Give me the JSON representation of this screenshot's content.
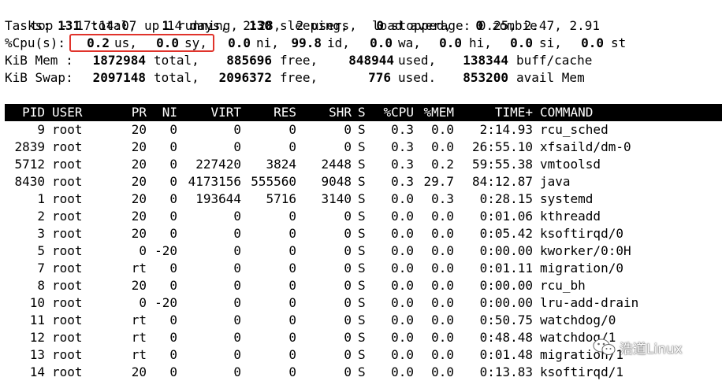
{
  "summary": {
    "line1": "top - 17:14:07 up 14 days,  2:28,  2 users,  load average: 0.25, 2.47, 2.91",
    "tasks": {
      "label": "Tasks:",
      "total": "131",
      "total_label": "total,",
      "running": "1",
      "running_label": "running,",
      "sleeping": "130",
      "sleeping_label": "sleeping,",
      "stopped": "0",
      "stopped_label": "stopped,",
      "zombie": "0",
      "zombie_label": "zombie"
    },
    "cpu": {
      "label": "%Cpu(s):",
      "us": "0.2",
      "us_label": "us,",
      "sy": "0.0",
      "sy_label": "sy,",
      "ni": "0.0",
      "ni_label": "ni,",
      "id": "99.8",
      "id_label": "id,",
      "wa": "0.0",
      "wa_label": "wa,",
      "hi": "0.0",
      "hi_label": "hi,",
      "si": "0.0",
      "si_label": "si,",
      "st": "0.0",
      "st_label": "st"
    },
    "mem": {
      "label": "KiB Mem :",
      "total": "1872984",
      "total_label": "total,",
      "free": "885696",
      "free_label": "free,",
      "used": "848944",
      "used_label": "used,",
      "buff": "138344",
      "buff_label": "buff/cache"
    },
    "swap": {
      "label": "KiB Swap:",
      "total": "2097148",
      "total_label": "total,",
      "free": "2096372",
      "free_label": "free,",
      "used": "776",
      "used_label": "used.",
      "avail": "853200",
      "avail_label": "avail Mem"
    }
  },
  "header": [
    "PID",
    "USER",
    "PR",
    "NI",
    "VIRT",
    "RES",
    "SHR",
    "S",
    "%CPU",
    "%MEM",
    "TIME+",
    "COMMAND"
  ],
  "processes": [
    [
      "9",
      "root",
      "20",
      "0",
      "0",
      "0",
      "0",
      "S",
      "0.3",
      "0.0",
      "2:14.93",
      "rcu_sched"
    ],
    [
      "2839",
      "root",
      "20",
      "0",
      "0",
      "0",
      "0",
      "S",
      "0.3",
      "0.0",
      "26:55.10",
      "xfsaild/dm-0"
    ],
    [
      "5712",
      "root",
      "20",
      "0",
      "227420",
      "3824",
      "2448",
      "S",
      "0.3",
      "0.2",
      "59:55.38",
      "vmtoolsd"
    ],
    [
      "8430",
      "root",
      "20",
      "0",
      "4173156",
      "555560",
      "9048",
      "S",
      "0.3",
      "29.7",
      "84:12.87",
      "java"
    ],
    [
      "1",
      "root",
      "20",
      "0",
      "193644",
      "5716",
      "3140",
      "S",
      "0.0",
      "0.3",
      "0:28.15",
      "systemd"
    ],
    [
      "2",
      "root",
      "20",
      "0",
      "0",
      "0",
      "0",
      "S",
      "0.0",
      "0.0",
      "0:01.06",
      "kthreadd"
    ],
    [
      "3",
      "root",
      "20",
      "0",
      "0",
      "0",
      "0",
      "S",
      "0.0",
      "0.0",
      "0:05.42",
      "ksoftirqd/0"
    ],
    [
      "5",
      "root",
      "0",
      "-20",
      "0",
      "0",
      "0",
      "S",
      "0.0",
      "0.0",
      "0:00.00",
      "kworker/0:0H"
    ],
    [
      "7",
      "root",
      "rt",
      "0",
      "0",
      "0",
      "0",
      "S",
      "0.0",
      "0.0",
      "0:01.11",
      "migration/0"
    ],
    [
      "8",
      "root",
      "20",
      "0",
      "0",
      "0",
      "0",
      "S",
      "0.0",
      "0.0",
      "0:00.00",
      "rcu_bh"
    ],
    [
      "10",
      "root",
      "0",
      "-20",
      "0",
      "0",
      "0",
      "S",
      "0.0",
      "0.0",
      "0:00.00",
      "lru-add-drain"
    ],
    [
      "11",
      "root",
      "rt",
      "0",
      "0",
      "0",
      "0",
      "S",
      "0.0",
      "0.0",
      "0:50.75",
      "watchdog/0"
    ],
    [
      "12",
      "root",
      "rt",
      "0",
      "0",
      "0",
      "0",
      "S",
      "0.0",
      "0.0",
      "0:48.48",
      "watchdog/1"
    ],
    [
      "13",
      "root",
      "rt",
      "0",
      "0",
      "0",
      "0",
      "S",
      "0.0",
      "0.0",
      "0:01.48",
      "migration/1"
    ],
    [
      "14",
      "root",
      "20",
      "0",
      "0",
      "0",
      "0",
      "S",
      "0.0",
      "0.0",
      "0:13.83",
      "ksoftirqd/1"
    ]
  ],
  "watermark": {
    "text": "浩道Linux",
    "icon": "wechat-icon"
  },
  "colors": {
    "highlight_border": "#e0332b",
    "header_bg": "#000000",
    "header_fg": "#ffffff"
  }
}
